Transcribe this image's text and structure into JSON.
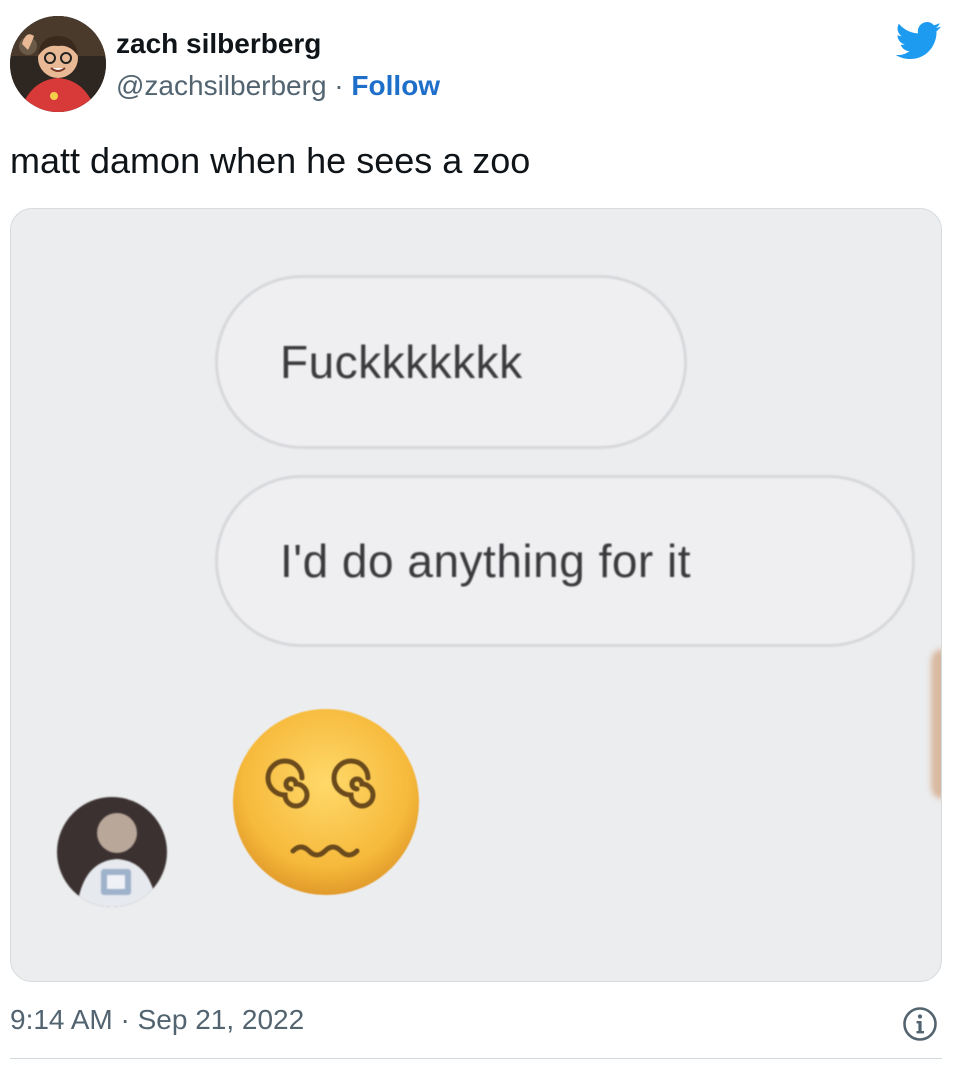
{
  "author": {
    "name": "zach silberberg",
    "handle": "@zachsilberberg",
    "separator": " · ",
    "follow_label": "Follow"
  },
  "tweet": {
    "text": "matt damon when he sees a zoo",
    "timestamp": "9:14 AM · Sep 21, 2022"
  },
  "media": {
    "messages": [
      "Fuckkkkkkk",
      "I'd do anything for it"
    ],
    "emoji": "dizzy-face-emoji"
  },
  "icons": {
    "brand": "twitter-bird-icon",
    "info": "info-icon"
  },
  "colors": {
    "link_blue": "#1d6fc9",
    "twitter_blue": "#1d9bf0",
    "secondary_text": "#536471"
  }
}
